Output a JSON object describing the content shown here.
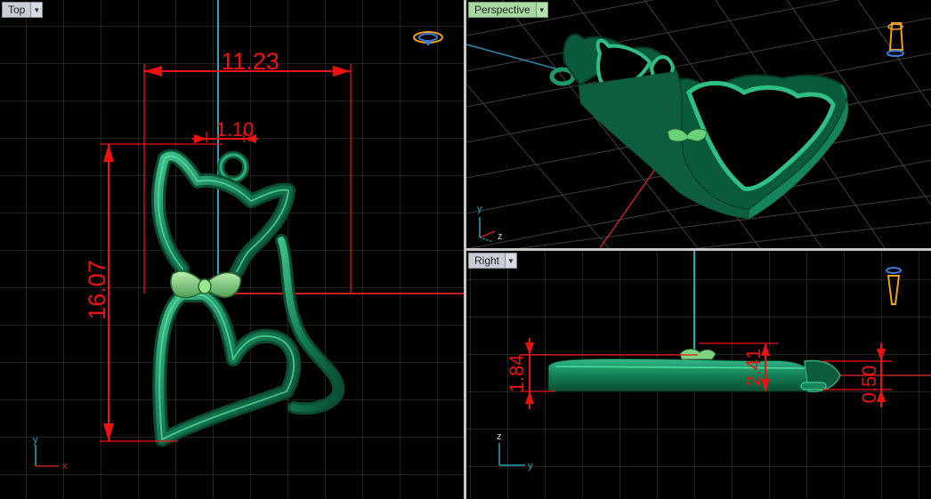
{
  "viewports": {
    "top": {
      "label": "Top"
    },
    "perspective": {
      "label": "Perspective"
    },
    "right": {
      "label": "Right"
    }
  },
  "dimensions": {
    "top": {
      "width": "11.23",
      "ring_gap": "1.10",
      "height": "16.07"
    },
    "right": {
      "total": "1.84",
      "bow": "2.41",
      "ring": "0.50"
    }
  },
  "axes": {
    "top": {
      "x": "x",
      "y": "y"
    },
    "perspective": {
      "y": "y",
      "z": "z"
    },
    "right": {
      "y": "y",
      "z": "z"
    }
  },
  "colors": {
    "model": "#1c8a5f",
    "dimension": "#ee1111",
    "grid": "#4a4a4a",
    "bow": "#7fd27f"
  },
  "icons": {
    "gizmo": "view-gizmo-icon",
    "dropdown": "chevron-down-icon"
  }
}
